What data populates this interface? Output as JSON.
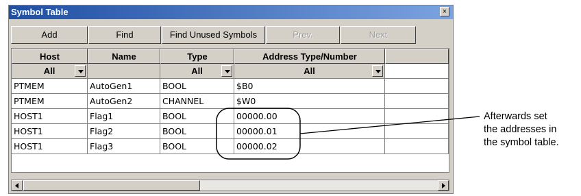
{
  "window": {
    "title": "Symbol Table",
    "close_glyph": "×"
  },
  "toolbar": {
    "add_label": "Add",
    "find_label": "Find",
    "find_unused_label": "Find Unused Symbols",
    "prev_label": "Prev.",
    "next_label": "Next"
  },
  "table": {
    "columns": [
      "Host",
      "Name",
      "Type",
      "Address Type/Number"
    ],
    "filters": {
      "host": "All",
      "name": "",
      "type": "All",
      "address": "All"
    },
    "rows": [
      {
        "host": "PTMEM",
        "name": "AutoGen1",
        "type": "BOOL",
        "address": "$B0"
      },
      {
        "host": "PTMEM",
        "name": "AutoGen2",
        "type": "CHANNEL",
        "address": "$W0"
      },
      {
        "host": "HOST1",
        "name": "Flag1",
        "type": "BOOL",
        "address": "00000.00"
      },
      {
        "host": "HOST1",
        "name": "Flag2",
        "type": "BOOL",
        "address": "00000.01"
      },
      {
        "host": "HOST1",
        "name": "Flag3",
        "type": "BOOL",
        "address": "00000.02"
      }
    ]
  },
  "annotation": {
    "line1": "Afterwards set",
    "line2": "the addresses in",
    "line3": "the symbol table."
  },
  "colors": {
    "titlebar_start": "#1f4ea3",
    "titlebar_end": "#7aa3e0",
    "window_face": "#d4d0c8"
  }
}
